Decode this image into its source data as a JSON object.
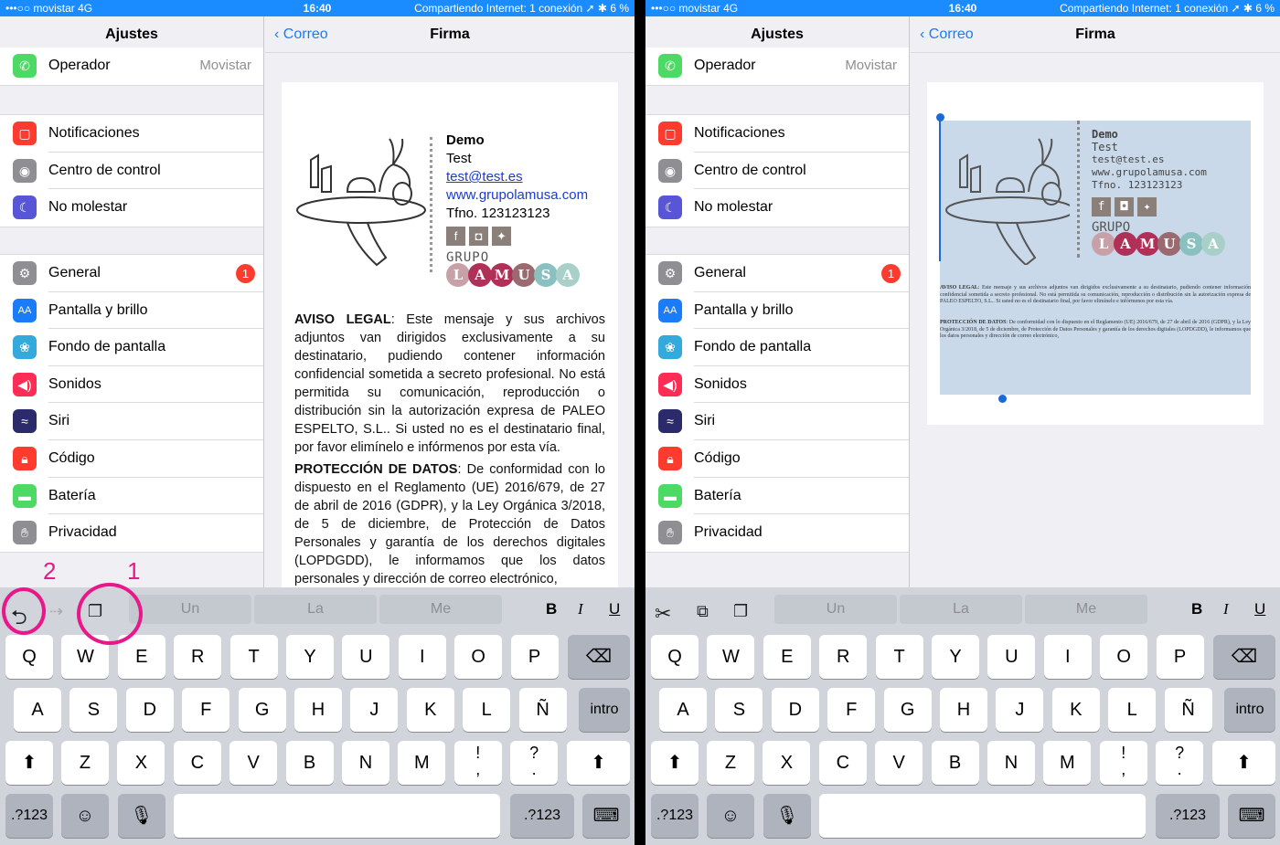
{
  "status_bar": {
    "carrier": "•••○○ movistar  4G",
    "time": "16:40",
    "right": "Compartiendo Internet: 1 conexión   ➚ ✱ 6 %"
  },
  "sidebar": {
    "title": "Ajustes",
    "operator": {
      "label": "Operador",
      "value": "Movistar"
    },
    "group2": [
      {
        "label": "Notificaciones",
        "color": "#ff3b30"
      },
      {
        "label": "Centro de control",
        "color": "#8e8e93"
      },
      {
        "label": "No molestar",
        "color": "#5856d6"
      }
    ],
    "group3": [
      {
        "label": "General",
        "color": "#8e8e93",
        "badge": "1"
      },
      {
        "label": "Pantalla y brillo",
        "color": "#1a7cf9"
      },
      {
        "label": "Fondo de pantalla",
        "color": "#34aadc"
      },
      {
        "label": "Sonidos",
        "color": "#ff2d55"
      },
      {
        "label": "Siri",
        "color": "#2b2b6b"
      },
      {
        "label": "Código",
        "color": "#ff3b30"
      },
      {
        "label": "Batería",
        "color": "#4cd964"
      },
      {
        "label": "Privacidad",
        "color": "#8e8e93"
      }
    ]
  },
  "detail": {
    "back": "Correo",
    "title": "Firma"
  },
  "signature": {
    "name": "Demo",
    "role": "Test",
    "email": "test@test.es",
    "website": "www.grupolamusa.com",
    "phone": "Tfno. 123123123",
    "brand_top": "GRUPO",
    "brand_letters": [
      "L",
      "A",
      "M",
      "U",
      "S",
      "A"
    ],
    "brand_colors": [
      "#c8a0a8",
      "#b03058",
      "#b03058",
      "#9a6a70",
      "#8ac0c0",
      "#a8d0c8"
    ],
    "legal_title": "AVISO LEGAL",
    "legal_text": ": Este mensaje y sus archivos adjuntos van dirigidos exclusivamente a su destinatario, pudiendo contener información confidencial sometida a secreto profesional. No está permitida su comunicación, reproducción o distribución sin la autorización expresa de PALEO ESPELTO, S.L.. Si usted no es el destinatario final, por favor elimínelo e infórmenos por esta vía.",
    "data_title": "PROTECCIÓN DE DATOS",
    "data_text": ": De conformidad con lo dispuesto en el Reglamento (UE) 2016/679, de 27 de abril de 2016 (GDPR), y la Ley Orgánica 3/2018, de 5 de diciembre, de Protección de Datos Personales y garantía de los derechos digitales (LOPDGDD), le informamos que los datos personales y dirección de correo electrónico,"
  },
  "keyboard": {
    "suggestions": [
      "Un",
      "La",
      "Me"
    ],
    "format": [
      "B",
      "I",
      "U"
    ],
    "row1": [
      "Q",
      "W",
      "E",
      "R",
      "T",
      "Y",
      "U",
      "I",
      "O",
      "P"
    ],
    "row2": [
      "A",
      "S",
      "D",
      "F",
      "G",
      "H",
      "J",
      "K",
      "L",
      "Ñ"
    ],
    "row3": [
      "Z",
      "X",
      "C",
      "V",
      "B",
      "N",
      "M",
      "!\n,",
      "?\n."
    ],
    "return": "intro",
    "numbers": ".?123"
  },
  "annotations": {
    "one": "1",
    "two": "2"
  }
}
